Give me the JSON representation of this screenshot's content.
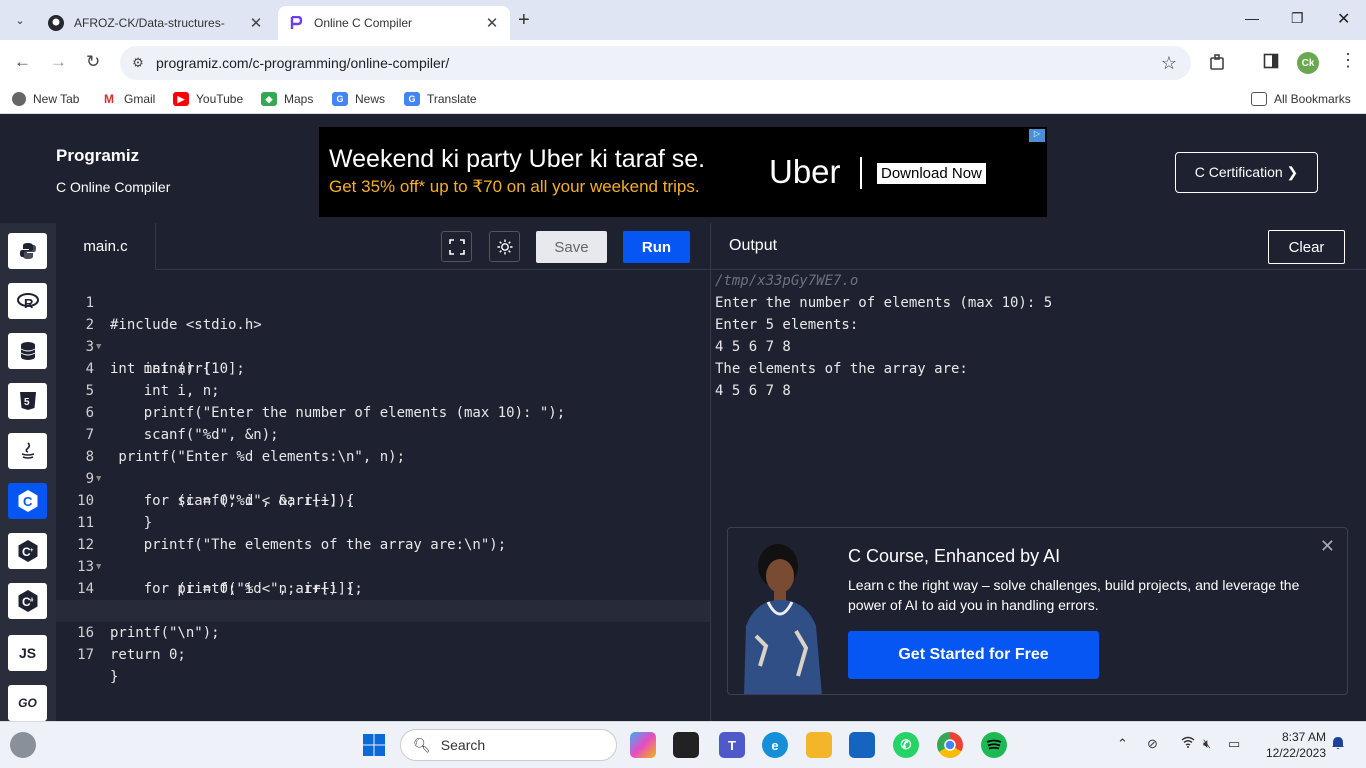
{
  "browser": {
    "tabs": [
      {
        "title": "AFROZ-CK/Data-structures-",
        "icon": "github-icon"
      },
      {
        "title": "Online C Compiler",
        "icon": "programiz-icon"
      }
    ],
    "url": "programiz.com/c-programming/online-compiler/",
    "profile_initials": "Ck",
    "bookmarks": [
      {
        "label": "New Tab"
      },
      {
        "label": "Gmail"
      },
      {
        "label": "YouTube"
      },
      {
        "label": "Maps"
      },
      {
        "label": "News"
      },
      {
        "label": "Translate"
      }
    ],
    "all_bookmarks": "All Bookmarks"
  },
  "site": {
    "logo": "Programiz",
    "subtitle": "C Online Compiler",
    "certification": "C Certification ❯",
    "ad": {
      "line1": "Weekend ki party Uber ki taraf se.",
      "line2": "Get 35% off* up to ₹70 on all your weekend trips.",
      "brand": "Uber",
      "cta": "Download Now"
    }
  },
  "editor": {
    "file": "main.c",
    "save": "Save",
    "run": "Run",
    "lines": [
      "#include <stdio.h>",
      "int main() {",
      "    int arr[10];",
      "    int i, n;",
      "    printf(\"Enter the number of elements (max 10): \");",
      "    scanf(\"%d\", &n);",
      " printf(\"Enter %d elements:\\n\", n);",
      "    for (i = 0; i < n; i++) {",
      "        scanf(\"%d\", &arr[i]);",
      "    }",
      "    printf(\"The elements of the array are:\\n\");",
      "    for (i = 0; i < n; i++) {",
      "        printf(\"%d \", arr[i]);",
      "    }",
      "printf(\"\\n\");",
      "return 0;",
      "}"
    ],
    "line_numbers": [
      "1",
      "2",
      "3",
      "4",
      "5",
      "6",
      "7",
      "8",
      "9",
      "10",
      "11",
      "12",
      "13",
      "14",
      "15",
      "16",
      "17"
    ]
  },
  "output": {
    "title": "Output",
    "clear": "Clear",
    "tmp": "/tmp/x33pGy7WE7.o",
    "lines": [
      "Enter the number of elements (max 10): 5",
      "Enter 5 elements:",
      "4 5 6 7 8",
      "The elements of the array are:",
      "4 5 6 7 8"
    ]
  },
  "promo": {
    "title": "C Course, Enhanced by AI",
    "text": "Learn c the right way – solve challenges, build projects, and leverage the power of AI to aid you in handling errors.",
    "cta": "Get Started for Free"
  },
  "sidebar": {
    "languages": [
      "python-icon",
      "r-icon",
      "sql-icon",
      "html-icon",
      "java-icon",
      "c-icon",
      "cpp-icon",
      "csharp-icon",
      "JS",
      "GO"
    ]
  },
  "taskbar": {
    "search": "Search",
    "time": "8:37 AM",
    "date": "12/22/2023"
  },
  "colors": {
    "accent": "#0556f3",
    "editor_bg": "#1e2130",
    "string": "#a6b5a0",
    "keyword": "#f1c36b",
    "number": "#e06c75"
  }
}
